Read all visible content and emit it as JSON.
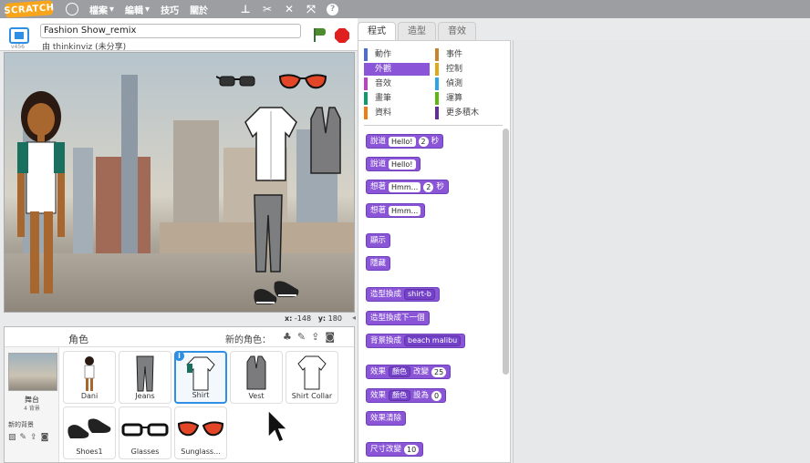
{
  "menubar": {
    "logo": "SCRATCH",
    "items": [
      {
        "label": "檔案",
        "arrow": "▾"
      },
      {
        "label": "編輯",
        "arrow": "▾"
      },
      {
        "label": "技巧",
        "arrow": ""
      },
      {
        "label": "關於",
        "arrow": ""
      }
    ],
    "tool_icons": [
      "stamp-icon",
      "scissors-icon",
      "grow-icon",
      "shrink-icon",
      "help-icon"
    ],
    "help_glyph": "?"
  },
  "stage_header": {
    "version": "v456",
    "project_title": "Fashion Show_remix",
    "byline": "由 thinkinviz (未分享)"
  },
  "stage": {
    "x_label": "x:",
    "x_value": "-148",
    "y_label": "y:",
    "y_value": "180"
  },
  "sprite_panel": {
    "title": "角色",
    "new_sprite_label": "新的角色：",
    "stage_label": "舞台",
    "stage_backdrops": "4 背景",
    "new_backdrop_label": "新的背景",
    "sprites": [
      {
        "name": "Dani",
        "selected": false
      },
      {
        "name": "Jeans",
        "selected": false
      },
      {
        "name": "Shirt",
        "selected": true
      },
      {
        "name": "Vest",
        "selected": false
      },
      {
        "name": "Shirt Collar",
        "selected": false
      },
      {
        "name": "Shoes1",
        "selected": false
      },
      {
        "name": "Glasses",
        "selected": false
      },
      {
        "name": "Sunglass...",
        "selected": false
      }
    ]
  },
  "tabs": [
    "程式",
    "造型",
    "音效"
  ],
  "active_tab": "程式",
  "categories": [
    {
      "label": "動作",
      "color": "#4a6cd4"
    },
    {
      "label": "事件",
      "color": "#c88330"
    },
    {
      "label": "外觀",
      "color": "#8a55d7",
      "active": true
    },
    {
      "label": "控制",
      "color": "#e1a91a"
    },
    {
      "label": "音效",
      "color": "#bb42c3"
    },
    {
      "label": "偵測",
      "color": "#2ca5e2"
    },
    {
      "label": "畫筆",
      "color": "#0e9a6c"
    },
    {
      "label": "運算",
      "color": "#5cb712"
    },
    {
      "label": "資料",
      "color": "#ee7d16"
    },
    {
      "label": "更多積木",
      "color": "#632d99"
    }
  ],
  "blocks": [
    {
      "text": "說道",
      "slot": "Hello!",
      "num": "2",
      "suffix": "秒"
    },
    {
      "text": "說道",
      "slot": "Hello!"
    },
    {
      "text": "想著",
      "slot": "Hmm...",
      "num": "2",
      "suffix": "秒"
    },
    {
      "text": "想著",
      "slot": "Hmm..."
    },
    {
      "text": "顯示"
    },
    {
      "text": "隱藏"
    },
    {
      "text": "造型換成",
      "dropdown": "shirt-b"
    },
    {
      "text": "造型換成下一個"
    },
    {
      "text": "背景換成",
      "dropdown": "beach malibu"
    },
    {
      "text": "效果",
      "dropdown": "顏色",
      "mid": "改變",
      "num": "25"
    },
    {
      "text": "效果",
      "dropdown": "顏色",
      "mid": "設為",
      "num": "0"
    },
    {
      "text": "效果清除"
    },
    {
      "text": "尺寸改變",
      "num": "10"
    }
  ],
  "colors": {
    "accent": "#2e8fe4",
    "looks": "#8a55d7",
    "menubar": "#9c9ea2"
  }
}
